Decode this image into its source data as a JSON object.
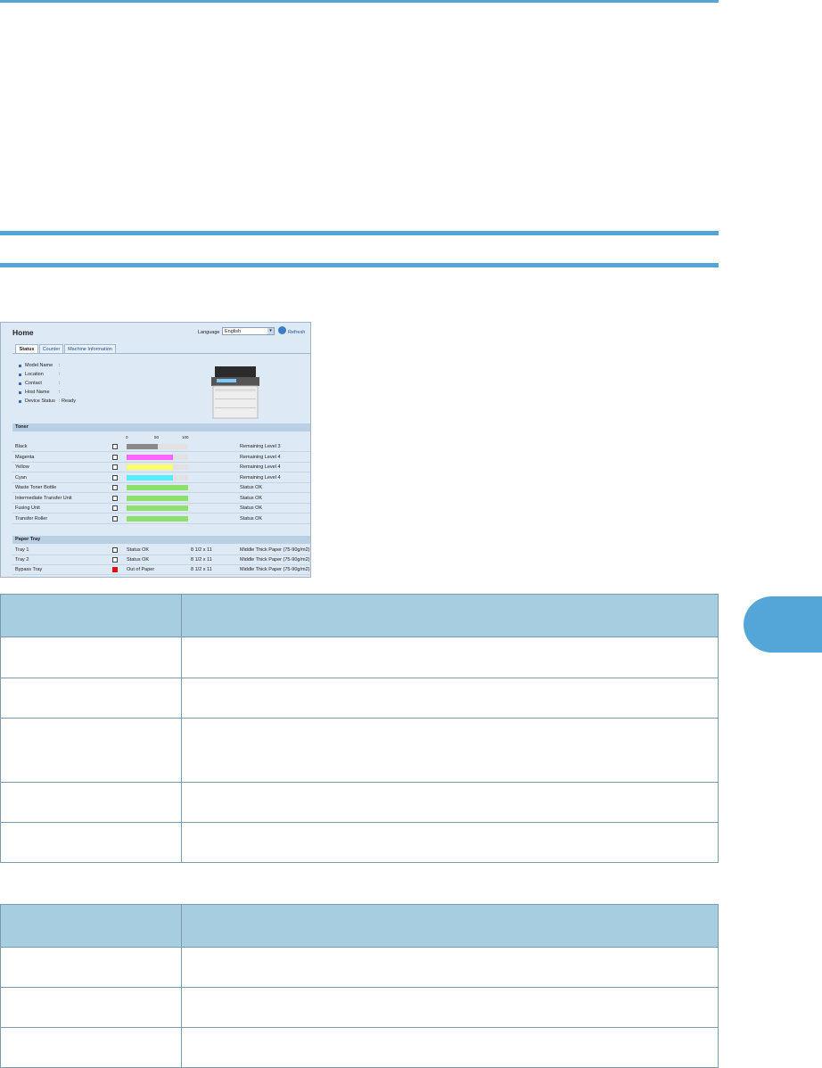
{
  "screenshot": {
    "title": "Home",
    "language_label": "Language",
    "language_value": "English",
    "refresh_label": "Refresh",
    "tabs": [
      "Status",
      "Counter",
      "Machine Information"
    ],
    "info": [
      {
        "label": "Model Name",
        "value": ":"
      },
      {
        "label": "Location",
        "value": ":"
      },
      {
        "label": "Contact",
        "value": ":"
      },
      {
        "label": "Host Name",
        "value": ":"
      },
      {
        "label": "Device Status",
        "value": ": Ready"
      }
    ],
    "toner_title": "Toner",
    "scale": [
      "0",
      "50",
      "100"
    ],
    "toner": [
      {
        "name": "Black",
        "level": 0.5,
        "color": "#8a8a8a",
        "status": "Remaining Level 3"
      },
      {
        "name": "Magenta",
        "level": 0.75,
        "color": "#ff66ff",
        "status": "Remaining Level 4"
      },
      {
        "name": "Yellow",
        "level": 0.75,
        "color": "#ffff66",
        "status": "Remaining Level 4"
      },
      {
        "name": "Cyan",
        "level": 0.75,
        "color": "#55eeff",
        "status": "Remaining Level 4"
      },
      {
        "name": "Waste Toner Bottle",
        "level": 1.0,
        "color": "#8ee06a",
        "status": "Status OK"
      },
      {
        "name": "Intermediate Transfer Unit",
        "level": 1.0,
        "color": "#8ee06a",
        "status": "Status OK"
      },
      {
        "name": "Fusing Unit",
        "level": 1.0,
        "color": "#8ee06a",
        "status": "Status OK"
      },
      {
        "name": "Transfer Roller",
        "level": 1.0,
        "color": "#8ee06a",
        "status": "Status OK"
      }
    ],
    "paper_title": "Paper Tray",
    "trays": [
      {
        "name": "Tray 1",
        "status": "Status OK",
        "size": "8 1/2 x 11",
        "type": "Middle Thick Paper (75-90g/m2)",
        "alert": false
      },
      {
        "name": "Tray 2",
        "status": "Status OK",
        "size": "8 1/2 x 11",
        "type": "Middle Thick Paper (75-90g/m2)",
        "alert": false
      },
      {
        "name": "Bypass Tray",
        "status": "Out of Paper",
        "size": "8 1/2 x 11",
        "type": "Middle Thick Paper (75-90g/m2)",
        "alert": true
      }
    ]
  },
  "colors": {
    "accent": "#55a6d8",
    "table_header": "#a6cde0",
    "panel": "#dde9f4"
  }
}
